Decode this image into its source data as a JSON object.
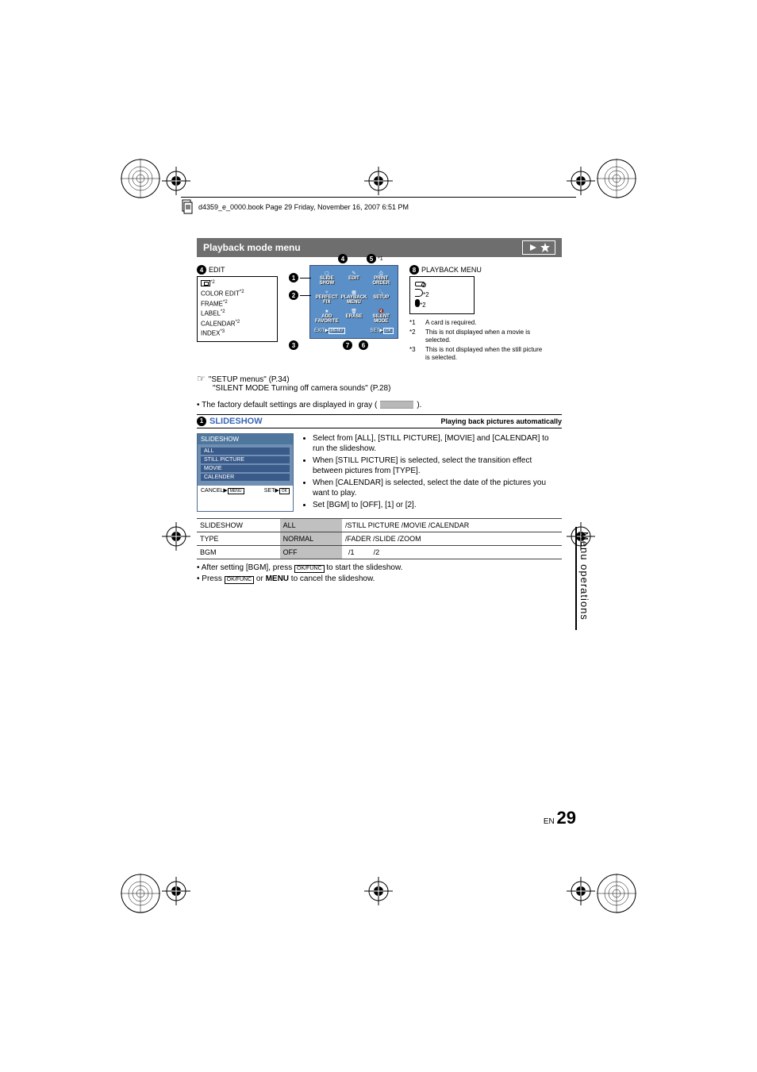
{
  "pageline": {
    "text": "d4359_e_0000.book  Page 29  Friday, November 16, 2007  6:51 PM"
  },
  "section_title": "Playback mode menu",
  "edit": {
    "header_num": "4",
    "header_label": "EDIT",
    "items": {
      "pic": "",
      "pic_sup": "*2",
      "coloredit": "COLOR EDIT",
      "coloredit_sup": "*2",
      "frame": "FRAME",
      "frame_sup": "*2",
      "label": "LABEL",
      "label_sup": "*2",
      "calendar": "CALENDAR",
      "calendar_sup": "*2",
      "index": "INDEX",
      "index_sup": "*3"
    }
  },
  "screen_nums": {
    "top4": "4",
    "top5": "5",
    "top5_sup": "*1",
    "left1": "1",
    "left2": "2",
    "bot3": "3",
    "bot7": "7",
    "bot6": "6"
  },
  "screen": {
    "cells": {
      "slide": "SLIDE SHOW",
      "edit": "EDIT",
      "print": "PRINT ORDER",
      "effect": "PERFECT FIX",
      "pbmenu": "PLAYBACK MENU",
      "setup": "SETUP",
      "addfav": "ADD FAVORITE",
      "erase": "ERASE",
      "silent": "SILENT MODE"
    },
    "exit_label": "EXIT",
    "exit_btn": "MENU",
    "set_label": "SET",
    "ok_btn": "OK"
  },
  "playback": {
    "num": "8",
    "label": "PLAYBACK MENU",
    "rot_sup": "*2",
    "mic_sup": "*2"
  },
  "footnotes": {
    "f1k": "*1",
    "f1": "A card is required.",
    "f2k": "*2",
    "f2": "This is not displayed when a movie is selected.",
    "f3k": "*3",
    "f3": "This is not displayed when the still picture is selected."
  },
  "refs": {
    "hand": "☞",
    "line1": "\"SETUP menus\" (P.34)",
    "line2": "\"SILENT MODE    Turning off camera sounds\" (P.28)"
  },
  "factory_note": "• The factory default settings are displayed in gray (",
  "factory_note_close": ").",
  "sub": {
    "num": "1",
    "title": "SLIDESHOW",
    "right": "Playing back pictures automatically"
  },
  "ss_screen": {
    "title": "SLIDESHOW",
    "all": "ALL",
    "still": "STILL PICTURE",
    "movie": "MOVIE",
    "cal": "CALENDER",
    "cancel": "CANCEL",
    "menu": "MENU",
    "set": "SET",
    "ok": "OK"
  },
  "bullets": {
    "b1": "Select from [ALL], [STILL PICTURE], [MOVIE] and [CALENDAR] to run the slideshow.",
    "b2": "When [STILL PICTURE] is selected, select the transition effect between pictures from [TYPE].",
    "b3": "When [CALENDAR] is selected, select the date of the pictures you want to play.",
    "b4": "Set [BGM] to [OFF], [1] or [2]."
  },
  "table": {
    "r1c1": "SLIDESHOW",
    "r1c2": "ALL",
    "r1c3": "/STILL PICTURE /MOVIE /CALENDAR",
    "r2c1": "TYPE",
    "r2c2": "NORMAL",
    "r2c3": "/FADER /SLIDE /ZOOM",
    "r3c1": "BGM",
    "r3c2": "OFF",
    "r3c3a": "/1",
    "r3c3b": "/2"
  },
  "after": {
    "l1a": "• After setting [BGM], press ",
    "key1": "OK/FUNC",
    "l1b": " to start the slideshow.",
    "l2a": "• Press ",
    "key2": "OK/FUNC",
    "l2b": " or ",
    "menu": "MENU",
    "l2c": " to cancel the slideshow."
  },
  "sidetab": "Menu operations",
  "pagenum_prefix": "EN",
  "pagenum": "29"
}
